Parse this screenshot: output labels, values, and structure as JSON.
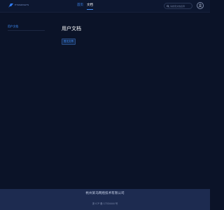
{
  "header": {
    "logo_text": "PYMARKETS",
    "nav": [
      {
        "label": "首页",
        "active": false
      },
      {
        "label": "文档",
        "active": true
      }
    ],
    "search": {
      "placeholder": "请搜索文档名称",
      "value": ""
    }
  },
  "sidebar": {
    "items": [
      {
        "label": "用户文档",
        "active": true
      }
    ]
  },
  "main": {
    "title": "用户文档",
    "badge": "暂无文章"
  },
  "footer": {
    "company": "杭州某马网络技术有限公司",
    "icp": "浙 ICP 备 17034444 号"
  },
  "colors": {
    "background": "#0b1328",
    "accent": "#3f8fff",
    "footer": "#1d2b50"
  }
}
